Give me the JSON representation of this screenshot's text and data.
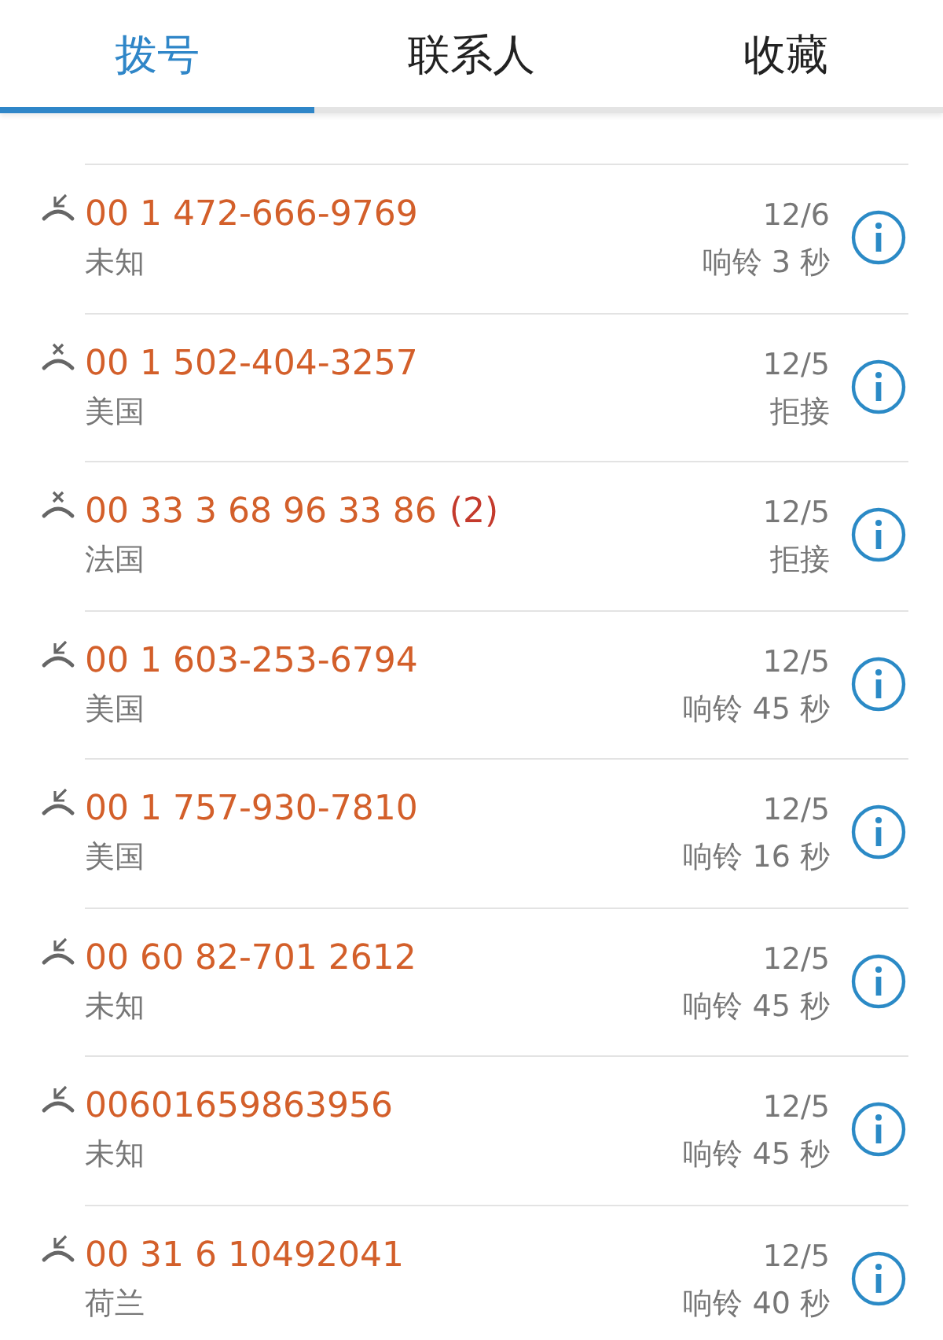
{
  "tabs": [
    {
      "label": "拨号",
      "selected": true
    },
    {
      "label": "联系人",
      "selected": false
    },
    {
      "label": "收藏",
      "selected": false
    }
  ],
  "calls": [
    {
      "kind": "missed",
      "number": "00 1 472-666-9769",
      "location": "未知",
      "date": "12/6",
      "detail": "响铃 3 秒"
    },
    {
      "kind": "rejected",
      "number": "00 1 502-404-3257",
      "location": "美国",
      "date": "12/5",
      "detail": "拒接"
    },
    {
      "kind": "rejected",
      "number": "00 33 3 68 96 33 86",
      "count": "(2)",
      "location": "法国",
      "date": "12/5",
      "detail": "拒接"
    },
    {
      "kind": "missed",
      "number": "00 1 603-253-6794",
      "location": "美国",
      "date": "12/5",
      "detail": "响铃 45 秒"
    },
    {
      "kind": "missed",
      "number": "00 1 757-930-7810",
      "location": "美国",
      "date": "12/5",
      "detail": "响铃 16 秒"
    },
    {
      "kind": "missed",
      "number": "00 60 82-701 2612",
      "location": "未知",
      "date": "12/5",
      "detail": "响铃 45 秒"
    },
    {
      "kind": "missed",
      "number": "00601659863956",
      "location": "未知",
      "date": "12/5",
      "detail": "响铃 45 秒"
    },
    {
      "kind": "missed",
      "number": "00 31 6 10492041",
      "location": "荷兰",
      "date": "12/5",
      "detail": "响铃 40 秒"
    }
  ]
}
